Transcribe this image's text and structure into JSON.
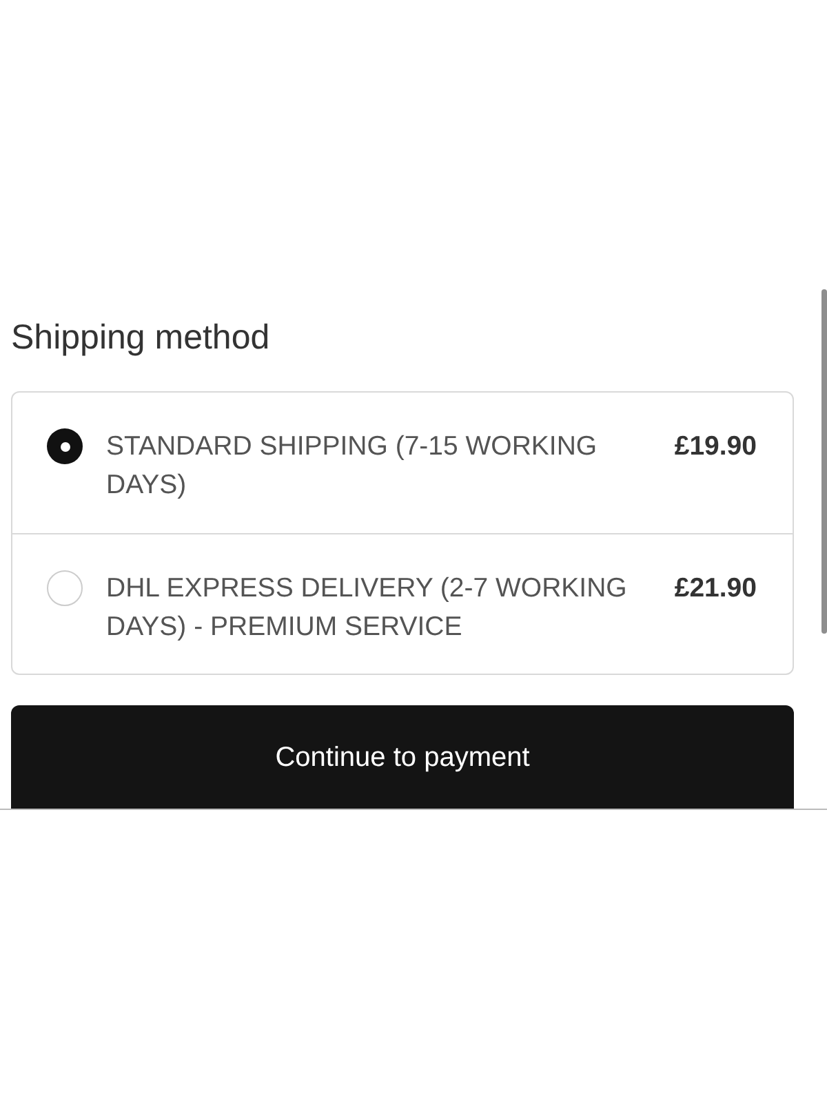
{
  "heading": "Shipping method",
  "options": [
    {
      "label": "STANDARD SHIPPING (7-15 WORKING DAYS)",
      "price": "£19.90",
      "selected": true
    },
    {
      "label": "DHL EXPRESS DELIVERY (2-7 WORKING DAYS) - PREMIUM SERVICE",
      "price": "£21.90",
      "selected": false
    }
  ],
  "button": "Continue to payment"
}
